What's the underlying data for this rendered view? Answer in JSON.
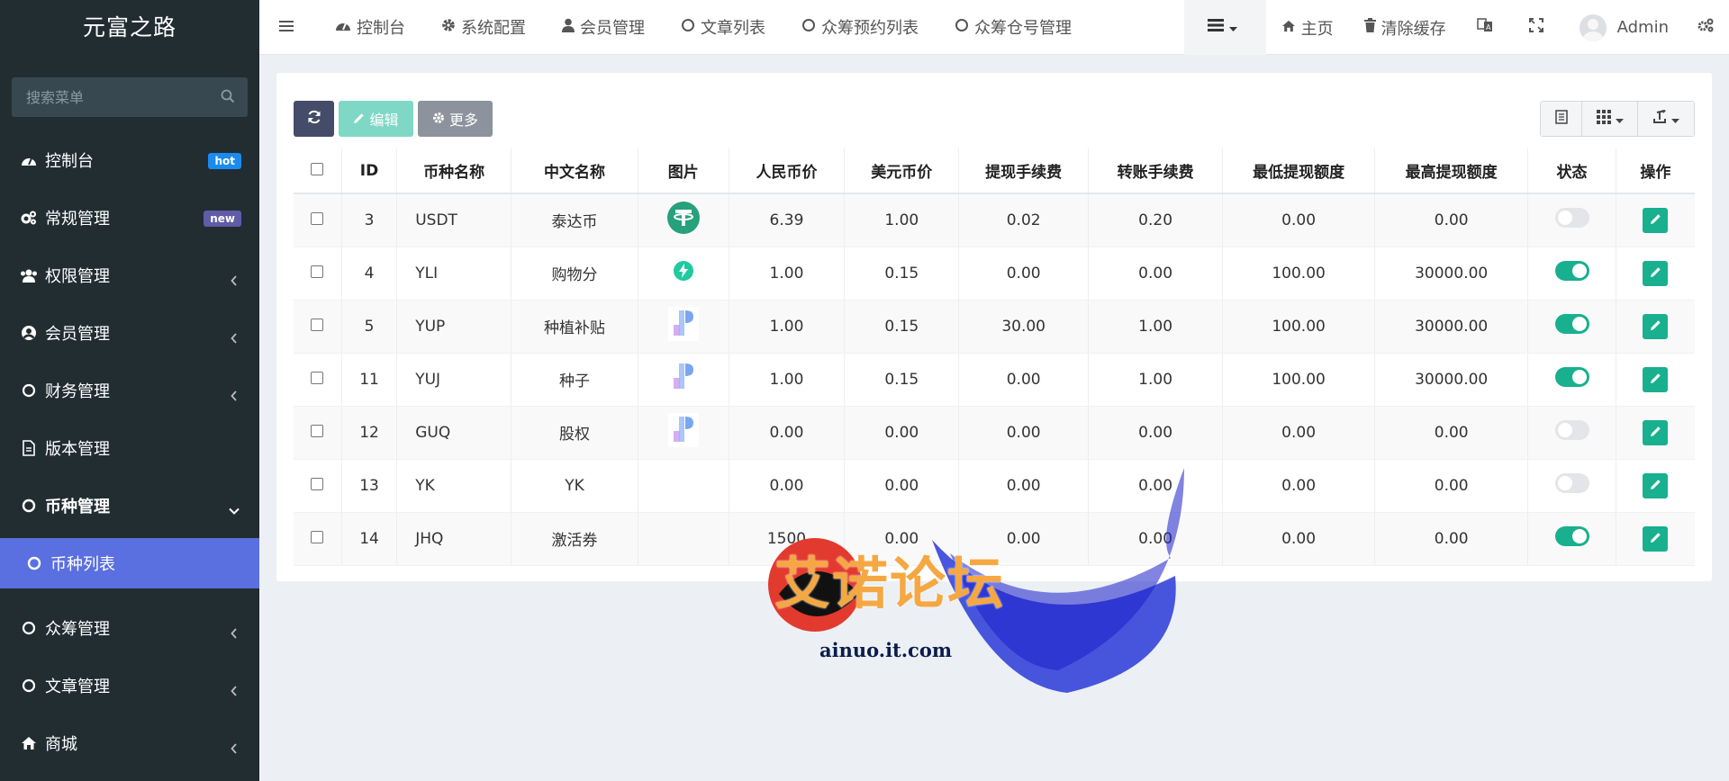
{
  "sidebar": {
    "logo": "元富之路",
    "search_placeholder": "搜索菜单",
    "items": [
      {
        "label": "控制台",
        "badge": "hot"
      },
      {
        "label": "常规管理",
        "badge": "new"
      },
      {
        "label": "权限管理"
      },
      {
        "label": "会员管理"
      },
      {
        "label": "财务管理"
      },
      {
        "label": "版本管理"
      },
      {
        "label": "币种管理"
      },
      {
        "label": "币种列表"
      },
      {
        "label": "众筹管理"
      },
      {
        "label": "文章管理"
      },
      {
        "label": "商城"
      }
    ]
  },
  "topnav": {
    "tabs": [
      "控制台",
      "系统配置",
      "会员管理",
      "文章列表",
      "众筹预约列表",
      "众筹仓号管理"
    ],
    "home": "主页",
    "clear_cache": "清除缓存",
    "user": "Admin"
  },
  "toolbar": {
    "edit": "编辑",
    "more": "更多"
  },
  "table": {
    "headers": [
      "ID",
      "币种名称",
      "中文名称",
      "图片",
      "人民币价",
      "美元币价",
      "提现手续费",
      "转账手续费",
      "最低提现额度",
      "最高提现额度",
      "状态",
      "操作"
    ],
    "rows": [
      {
        "id": "3",
        "code": "USDT",
        "name": "泰达币",
        "img": "tether",
        "cny": "6.39",
        "usd": "1.00",
        "wfee": "0.02",
        "tfee": "0.20",
        "min": "0.00",
        "max": "0.00",
        "status": "off"
      },
      {
        "id": "4",
        "code": "YLI",
        "name": "购物分",
        "img": "bolt",
        "cny": "1.00",
        "usd": "0.15",
        "wfee": "0.00",
        "tfee": "0.00",
        "min": "100.00",
        "max": "30000.00",
        "status": "on"
      },
      {
        "id": "5",
        "code": "YUP",
        "name": "种植补贴",
        "img": "p-logo",
        "cny": "1.00",
        "usd": "0.15",
        "wfee": "30.00",
        "tfee": "1.00",
        "min": "100.00",
        "max": "30000.00",
        "status": "on"
      },
      {
        "id": "11",
        "code": "YUJ",
        "name": "种子",
        "img": "p-logo",
        "cny": "1.00",
        "usd": "0.15",
        "wfee": "0.00",
        "tfee": "1.00",
        "min": "100.00",
        "max": "30000.00",
        "status": "on"
      },
      {
        "id": "12",
        "code": "GUQ",
        "name": "股权",
        "img": "p-logo",
        "cny": "0.00",
        "usd": "0.00",
        "wfee": "0.00",
        "tfee": "0.00",
        "min": "0.00",
        "max": "0.00",
        "status": "off"
      },
      {
        "id": "13",
        "code": "YK",
        "name": "YK",
        "img": "",
        "cny": "0.00",
        "usd": "0.00",
        "wfee": "0.00",
        "tfee": "0.00",
        "min": "0.00",
        "max": "0.00",
        "status": "off"
      },
      {
        "id": "14",
        "code": "JHQ",
        "name": "激活券",
        "img": "",
        "cny": "1500",
        "usd": "0.00",
        "wfee": "0.00",
        "tfee": "0.00",
        "min": "0.00",
        "max": "0.00",
        "status": "on"
      }
    ]
  },
  "watermark": {
    "text": "艾诺论坛",
    "url": "ainuo.it.com"
  },
  "colors": {
    "sidebar_bg": "#222d32",
    "active_item": "#5a6fe0",
    "success": "#18b08f",
    "refresh_btn": "#444c69"
  }
}
